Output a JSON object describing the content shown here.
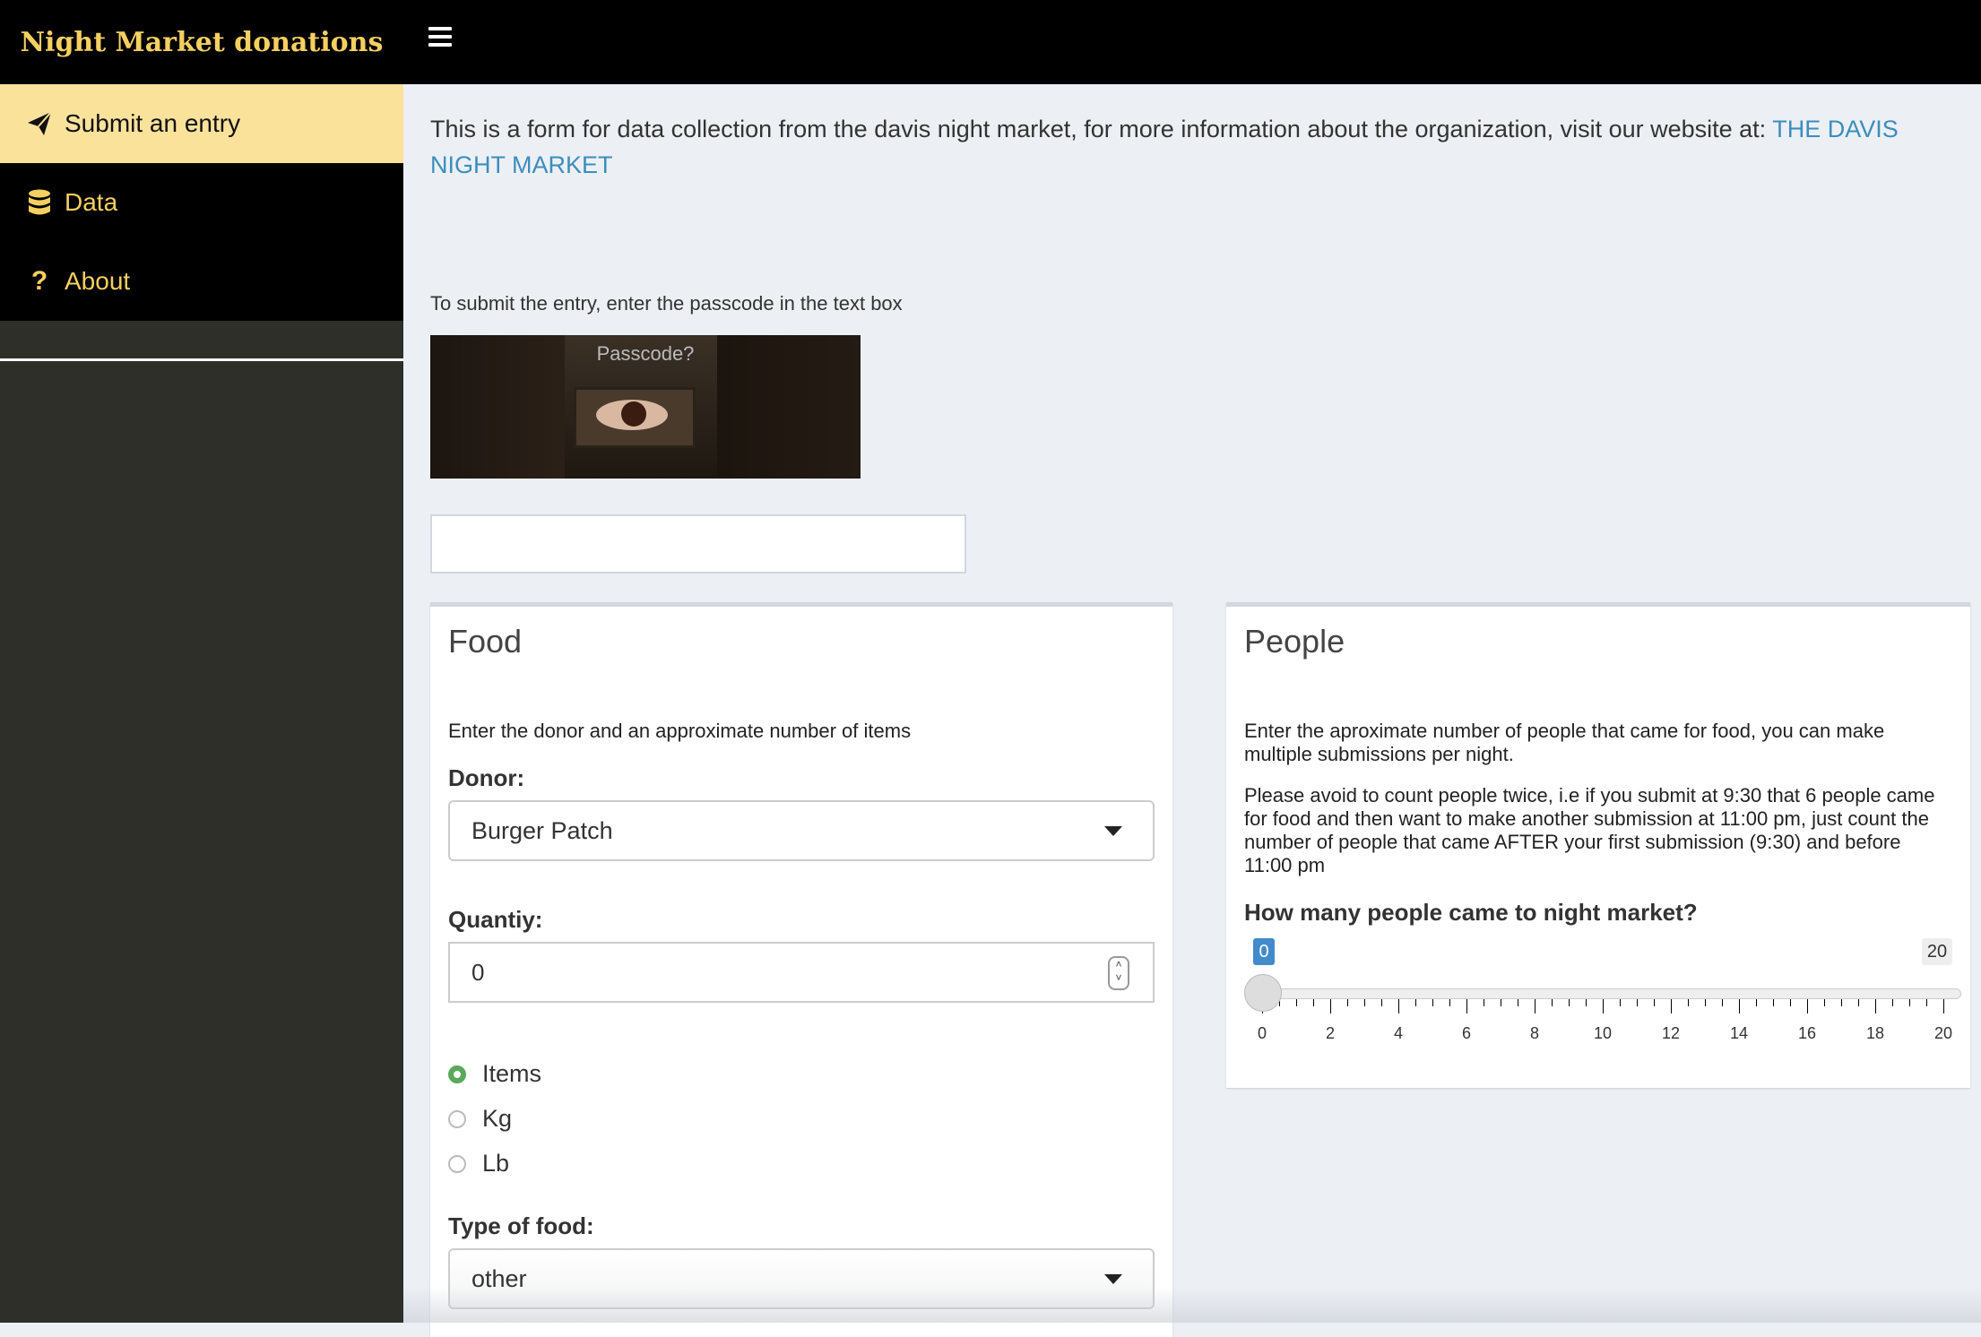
{
  "header": {
    "brand": "Night Market donations",
    "menu_icon": "hamburger-icon"
  },
  "sidebar": {
    "items": [
      {
        "label": "Submit an entry",
        "icon": "paper-plane-icon",
        "active": true
      },
      {
        "label": "Data",
        "icon": "database-icon",
        "active": false
      },
      {
        "label": "About",
        "icon": "question-icon",
        "active": false
      }
    ]
  },
  "intro": {
    "text": "This is a form for data collection from the davis night market, for more information about the organization, visit our website at: ",
    "link": "THE DAVIS NIGHT MARKET"
  },
  "passcode": {
    "label": "To submit the entry, enter the passcode in the text box",
    "image_text": "Passcode?",
    "value": ""
  },
  "food": {
    "title": "Food",
    "description": "Enter the donor and an approximate number of items",
    "donor_label": "Donor:",
    "donor_value": "Burger Patch",
    "quantity_label": "Quantiy:",
    "quantity_value": "0",
    "units": [
      {
        "label": "Items",
        "checked": true
      },
      {
        "label": "Kg",
        "checked": false
      },
      {
        "label": "Lb",
        "checked": false
      }
    ],
    "type_label": "Type of food:",
    "type_value": "other"
  },
  "people": {
    "title": "People",
    "description": "Enter the aproximate number of people that came for food, you can make multiple submissions per night.",
    "note": "Please avoid to count people twice, i.e if you submit at 9:30 that 6 people came for food and then want to make another submission at 11:00 pm, just count the number of people that came AFTER your first submission (9:30) and before 11:00 pm",
    "slider_label": "How many people came to night market?",
    "slider": {
      "min": 0,
      "max": 20,
      "value": 0,
      "min_badge": "0",
      "max_badge": "20",
      "tick_labels": [
        "0",
        "2",
        "4",
        "6",
        "8",
        "10",
        "12",
        "14",
        "16",
        "18",
        "20"
      ]
    }
  },
  "colors": {
    "accent": "#f5d060",
    "active_nav": "#fbe29b",
    "radio_checked": "#5ba95b",
    "link": "#3c8dbc",
    "slider_badge": "#428bca"
  }
}
